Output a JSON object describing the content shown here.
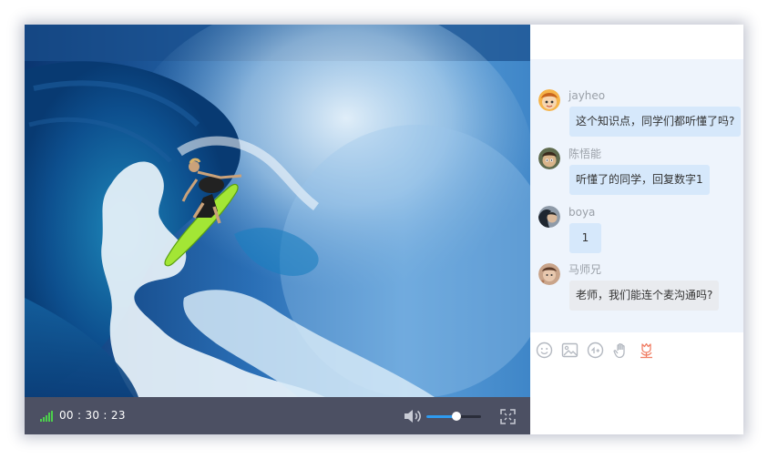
{
  "player": {
    "elapsed": "00 : 30 : 23",
    "volume_level": 0.55
  },
  "chat": {
    "messages": [
      {
        "name": "jayheo",
        "text": "这个知识点，同学们都听懂了吗?",
        "avatar": "cartoon-boy-avatar",
        "style": "blue"
      },
      {
        "name": "陈悟能",
        "text": "听懂了的同学，回复数字1",
        "avatar": "cartoon-character-avatar",
        "style": "blue"
      },
      {
        "name": "boya",
        "text": "1",
        "avatar": "photo-avatar",
        "style": "blue"
      },
      {
        "name": "马师兄",
        "text": "老师，我们能连个麦沟通吗?",
        "avatar": "photo-avatar",
        "style": "grey"
      }
    ],
    "toolbar": [
      "emoji-icon",
      "image-icon",
      "gift-icon",
      "raise-hand-icon",
      "flower-icon"
    ]
  },
  "colors": {
    "accent": "#2e9bf0",
    "control_bar": "#4c5063",
    "chat_background": "#eef4fc",
    "bubble_blue": "#d6e8fb",
    "bubble_grey": "#e9ebef",
    "flower": "#f07f66",
    "signal": "#4ccf4c"
  }
}
